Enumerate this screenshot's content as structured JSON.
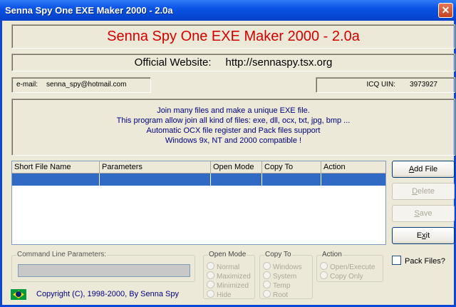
{
  "window": {
    "title": "Senna Spy One EXE Maker 2000 - 2.0a",
    "close": "✕"
  },
  "header": {
    "headline": "Senna Spy One EXE Maker 2000 - 2.0a",
    "website_label": "Official Website:",
    "website_url": "http://sennaspy.tsx.org",
    "email_label": "e-mail:",
    "email_value": "senna_spy@hotmail.com",
    "icq_label": "ICQ UIN:",
    "icq_value": "3973927"
  },
  "description": [
    "Join many files and make a unique EXE file.",
    "This program allow join all kind of files:  exe, dll, ocx, txt, jpg, bmp ...",
    "Automatic OCX file register and Pack files support",
    "Windows 9x, NT and 2000 compatible !"
  ],
  "file_list": {
    "columns": [
      "Short File Name",
      "Parameters",
      "Open Mode",
      "Copy To",
      "Action"
    ],
    "rows": [
      [
        "",
        "",
        "",
        "",
        ""
      ]
    ]
  },
  "buttons": {
    "add_file_u": "A",
    "add_file_rest": "dd File",
    "delete_u": "D",
    "delete_rest": "elete",
    "save_u": "S",
    "save_rest": "ave",
    "exit_pre": "E",
    "exit_u": "x",
    "exit_rest": "it"
  },
  "pack_files_label": "Pack Files?",
  "command_line": {
    "label": "Command Line Parameters:",
    "value": ""
  },
  "open_mode": {
    "label": "Open Mode",
    "options": [
      "Normal",
      "Maximized",
      "Minimized",
      "Hide"
    ]
  },
  "copy_to": {
    "label": "Copy To",
    "options": [
      "Windows",
      "System",
      "Temp",
      "Root"
    ]
  },
  "action": {
    "label": "Action",
    "options": [
      "Open/Execute",
      "Copy Only"
    ]
  },
  "footer": {
    "copyright": "Copyright (C), 1998-2000, By Senna Spy"
  },
  "colors": {
    "title_bar": "#0a53e6",
    "headline": "#d40000",
    "info_text": "#000080",
    "selection": "#316ac5"
  }
}
